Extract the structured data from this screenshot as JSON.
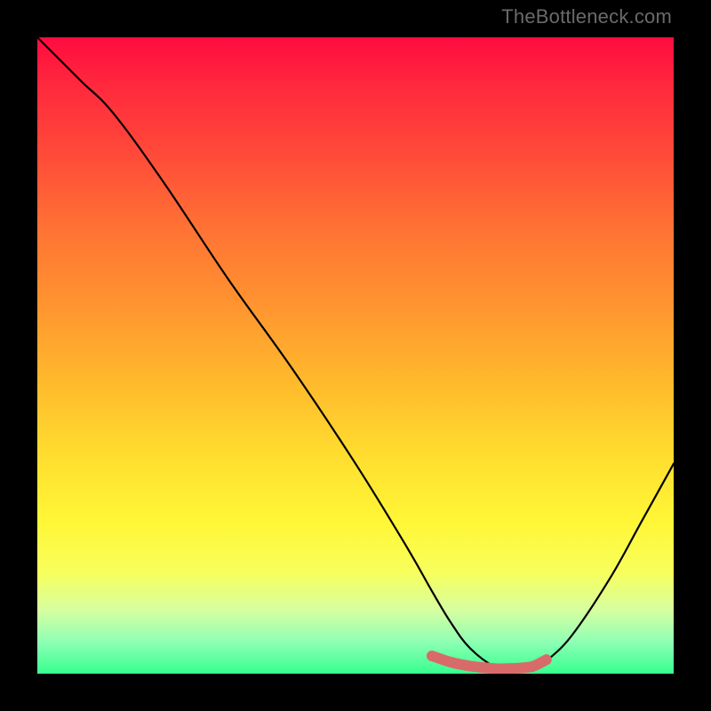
{
  "watermark": "TheBottleneck.com",
  "chart_data": {
    "type": "line",
    "title": "",
    "xlabel": "",
    "ylabel": "",
    "xlim": [
      0,
      100
    ],
    "ylim": [
      0,
      100
    ],
    "grid": false,
    "series": [
      {
        "name": "bottleneck-curve",
        "color": "#000000",
        "x": [
          0,
          3,
          7,
          12,
          20,
          30,
          40,
          50,
          58,
          62,
          65,
          68,
          72,
          75,
          78,
          80,
          84,
          90,
          95,
          100
        ],
        "y": [
          100,
          97,
          93,
          88,
          77,
          62,
          48,
          33,
          20,
          13,
          8,
          4,
          1,
          0.5,
          0.5,
          2,
          6,
          15,
          24,
          33
        ]
      },
      {
        "name": "optimal-zone-highlight",
        "color": "#d96a6a",
        "x": [
          62,
          65,
          68,
          72,
          74,
          76,
          78,
          80
        ],
        "y": [
          2.8,
          1.8,
          1.2,
          0.8,
          0.8,
          0.9,
          1.2,
          2.2
        ]
      }
    ],
    "gradient_stops": [
      {
        "pos": 0,
        "color": "#ff0b3f"
      },
      {
        "pos": 8,
        "color": "#ff2a3d"
      },
      {
        "pos": 18,
        "color": "#ff4939"
      },
      {
        "pos": 30,
        "color": "#ff7234"
      },
      {
        "pos": 42,
        "color": "#ff9430"
      },
      {
        "pos": 54,
        "color": "#ffb92c"
      },
      {
        "pos": 66,
        "color": "#ffde2f"
      },
      {
        "pos": 76,
        "color": "#fff636"
      },
      {
        "pos": 84,
        "color": "#f8ff5c"
      },
      {
        "pos": 90,
        "color": "#d6ffa0"
      },
      {
        "pos": 95,
        "color": "#8effb4"
      },
      {
        "pos": 100,
        "color": "#36ff8e"
      }
    ]
  }
}
